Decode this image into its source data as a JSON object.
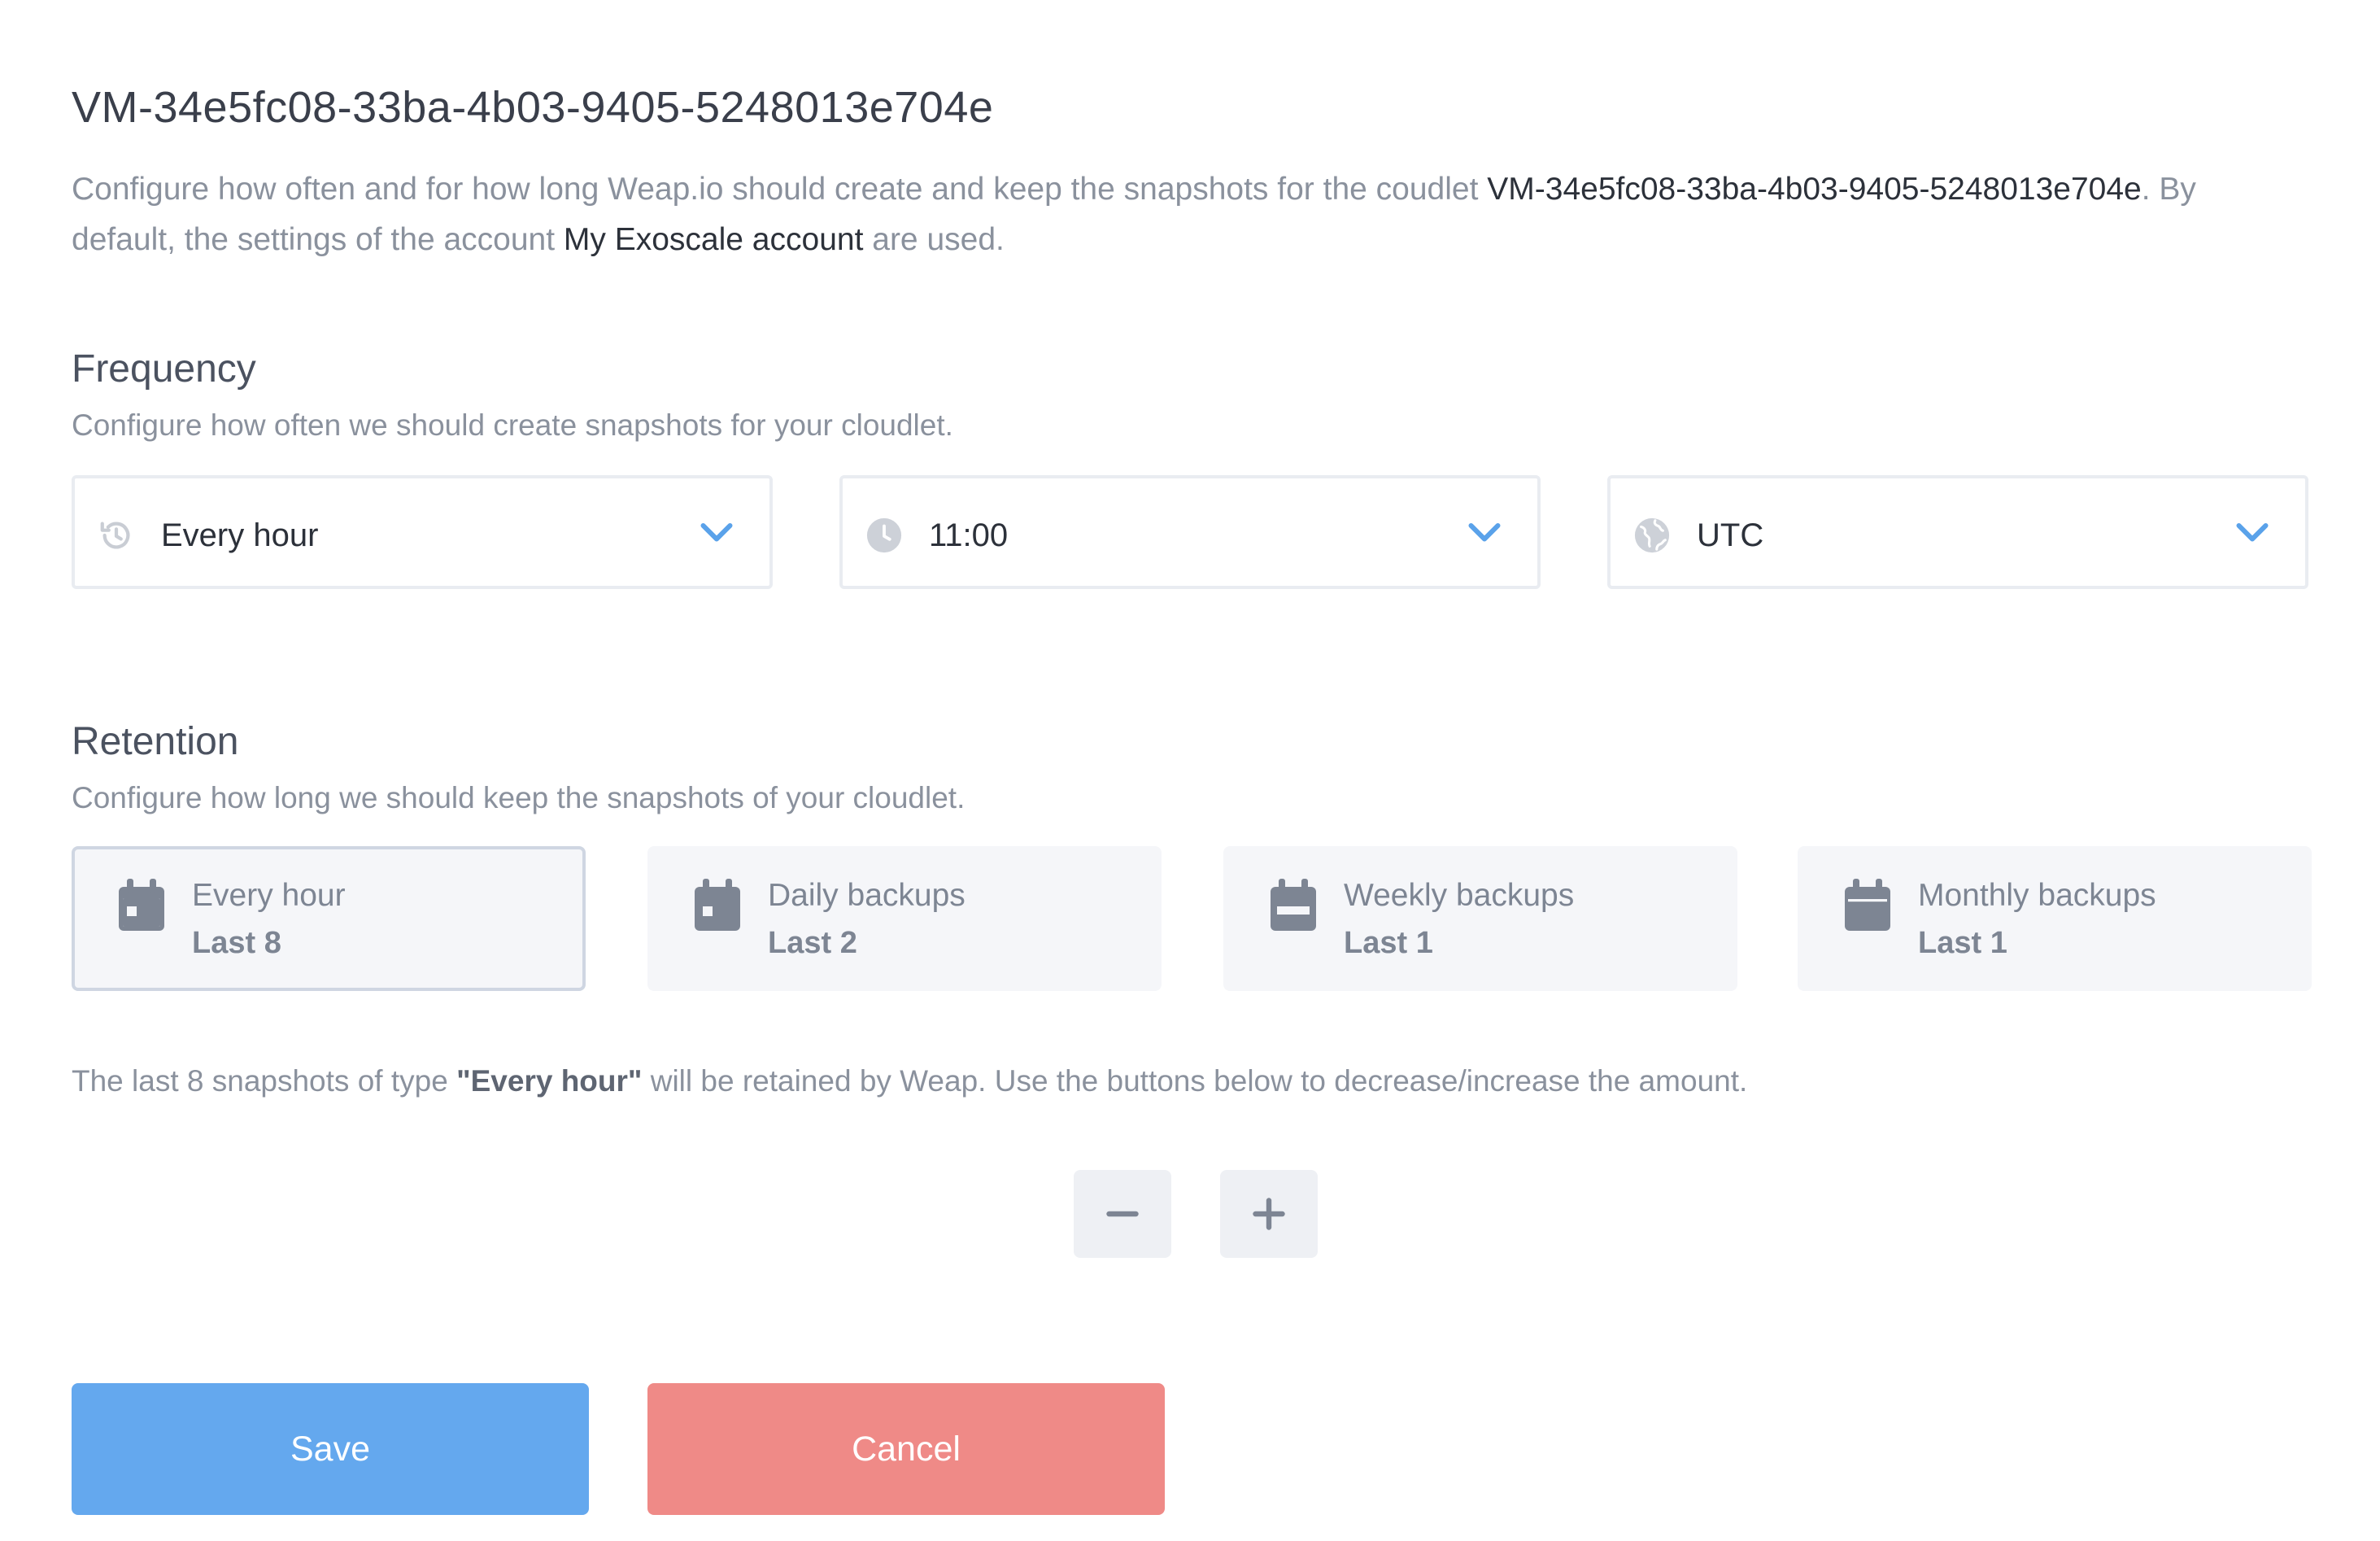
{
  "page": {
    "title": "VM-34e5fc08-33ba-4b03-9405-5248013e704e"
  },
  "intro": {
    "part1": "Configure how often and for how long Weap.io should create and keep the snapshots for the coudlet ",
    "cloudlet_name": "VM-34e5fc08-33ba-4b03-9405-5248013e704e",
    "part2": ". By default, the settings of the account ",
    "account_name": "My Exoscale account",
    "part3": " are used."
  },
  "frequency": {
    "title": "Frequency",
    "description": "Configure how often we should create snapshots for your cloudlet.",
    "interval": {
      "value": "Every hour",
      "icon": "history-icon"
    },
    "time": {
      "value": "11:00",
      "icon": "clock-icon"
    },
    "timezone": {
      "value": "UTC",
      "icon": "globe-icon"
    }
  },
  "retention": {
    "title": "Retention",
    "description": "Configure how long we should keep the snapshots of your cloudlet.",
    "cards": [
      {
        "label": "Every hour",
        "value": "Last 8",
        "icon": "calendar-day-icon",
        "selected": true
      },
      {
        "label": "Daily backups",
        "value": "Last 2",
        "icon": "calendar-day-icon",
        "selected": false
      },
      {
        "label": "Weekly backups",
        "value": "Last 1",
        "icon": "calendar-week-icon",
        "selected": false
      },
      {
        "label": "Monthly backups",
        "value": "Last 1",
        "icon": "calendar-month-icon",
        "selected": false
      }
    ],
    "note_part1": "The last 8 snapshots of type ",
    "note_type": "\"Every hour\"",
    "note_part2": " will be retained by Weap. Use the buttons below to decrease/increase the amount."
  },
  "stepper": {
    "decrease_icon": "minus-icon",
    "increase_icon": "plus-icon"
  },
  "actions": {
    "save_label": "Save",
    "cancel_label": "Cancel"
  },
  "colors": {
    "accent": "#64a8ee",
    "danger": "#ef8a87",
    "chevron": "#5aa2ea",
    "card_bg": "#f5f6f9"
  }
}
